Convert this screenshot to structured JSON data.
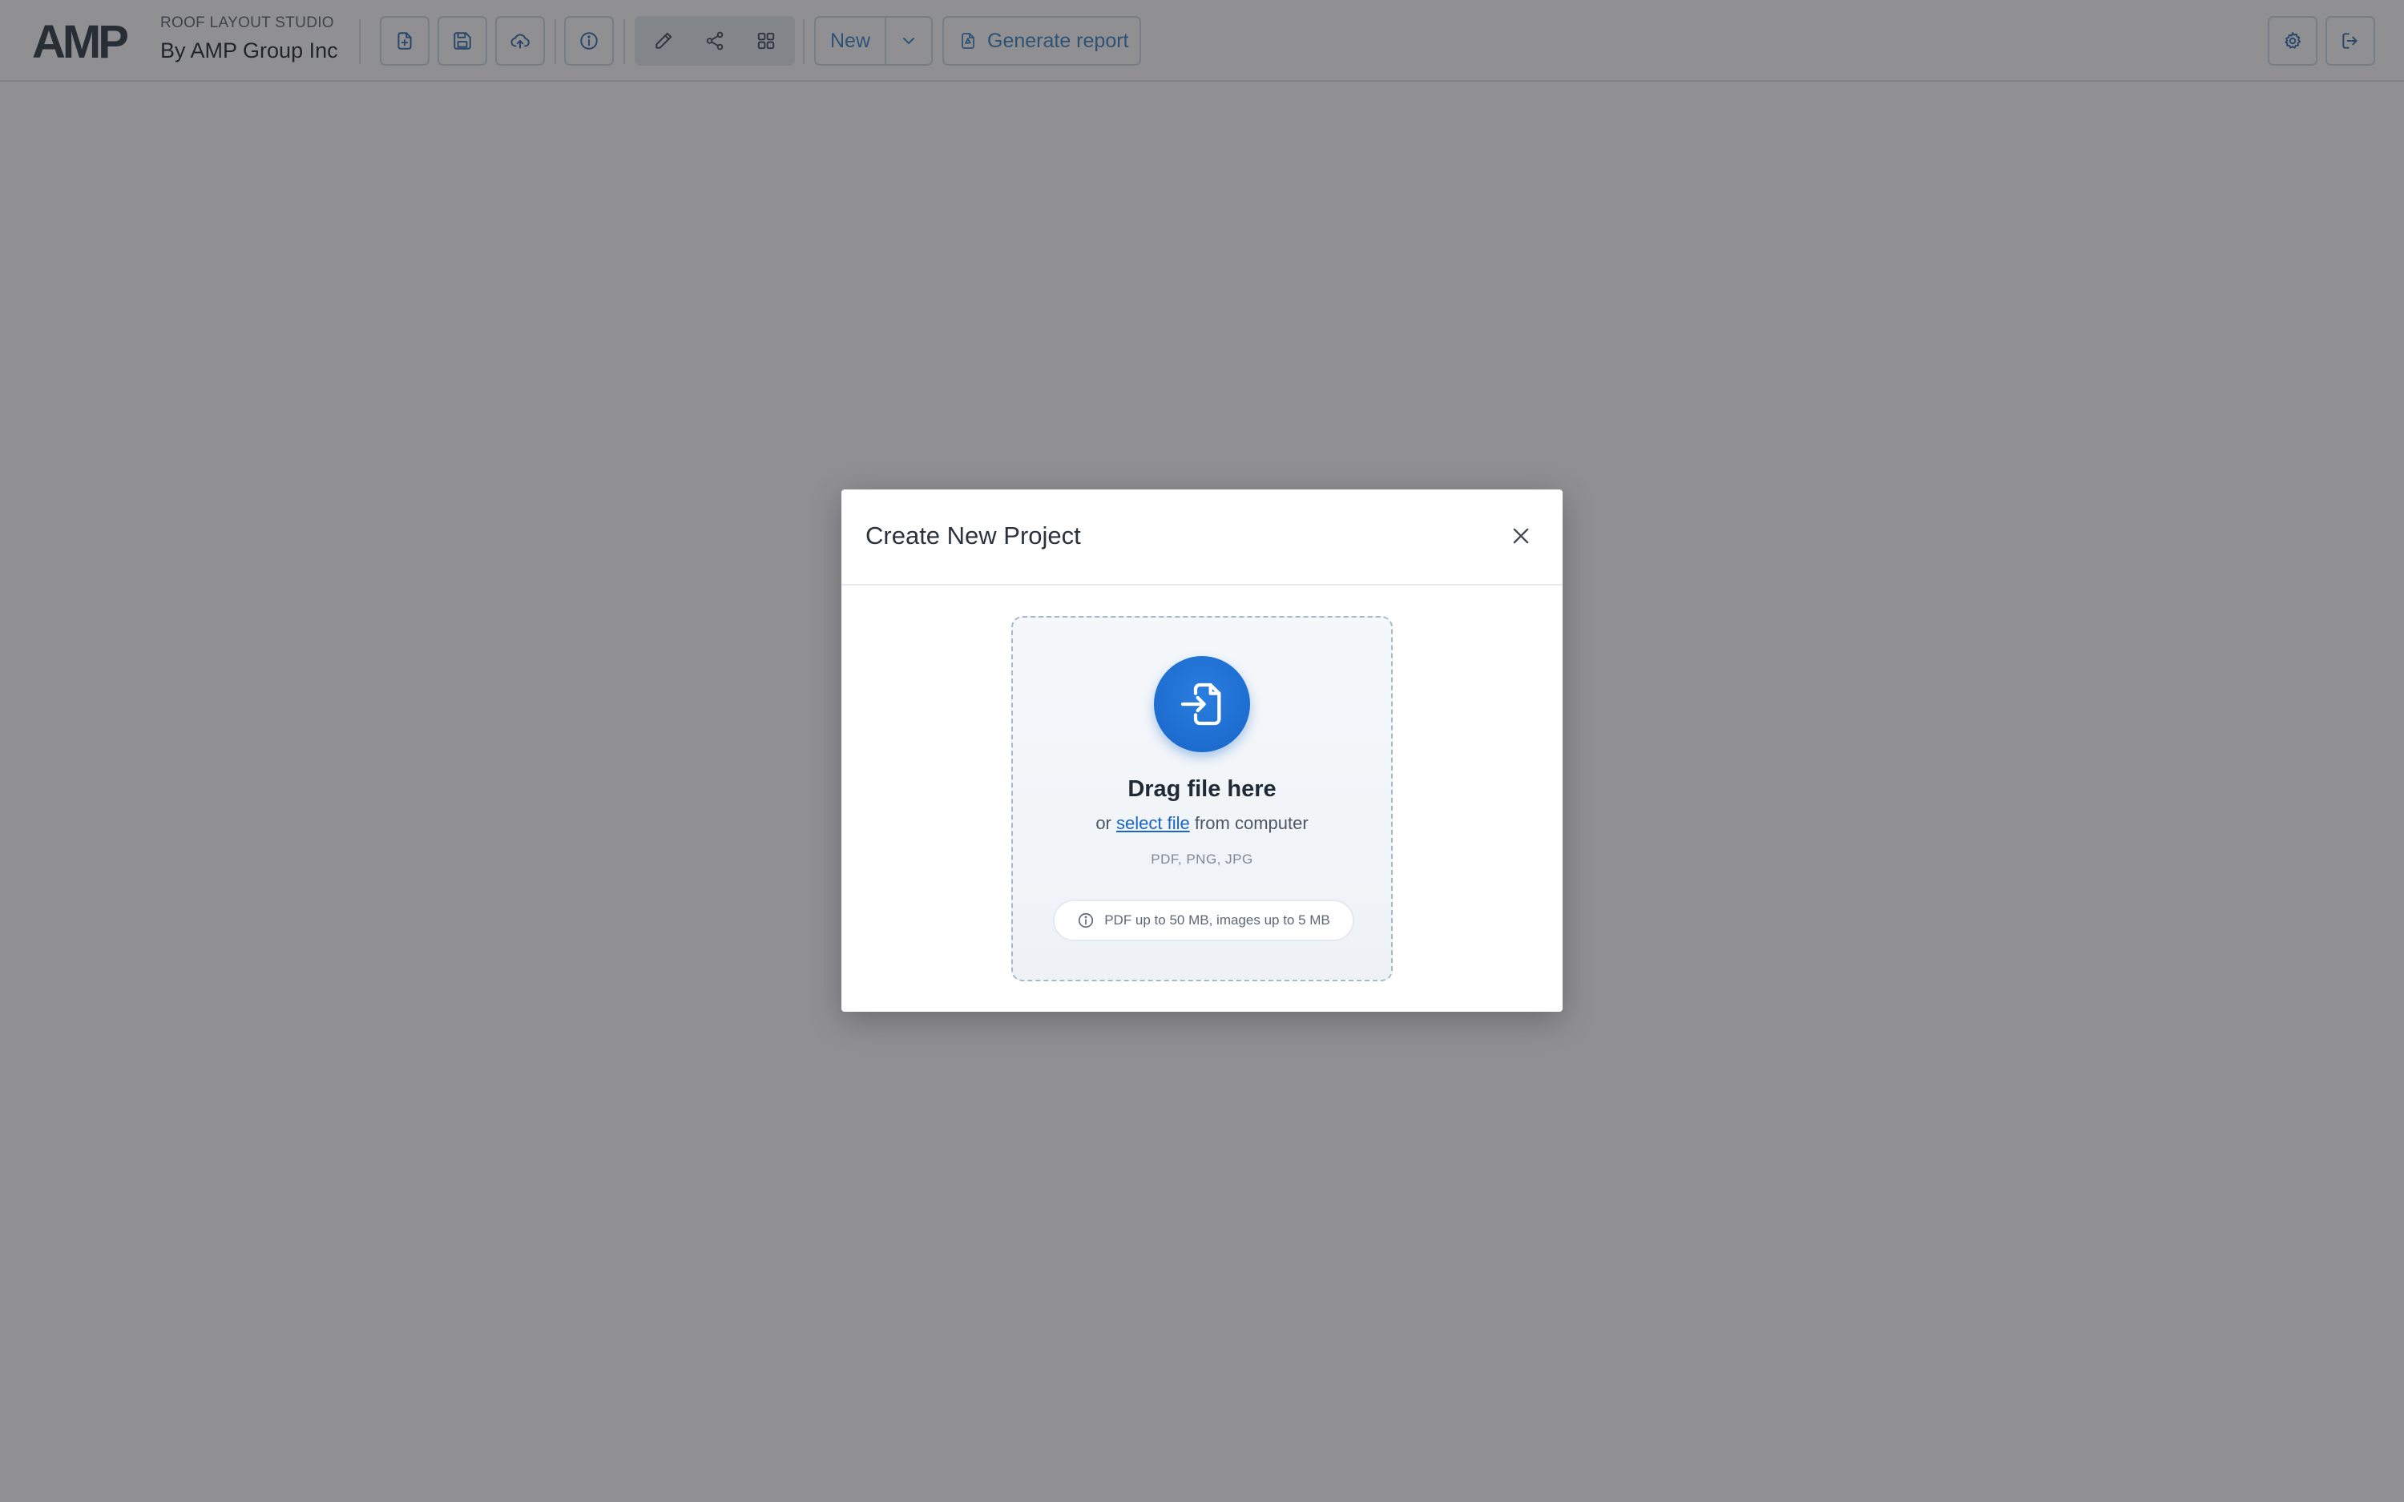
{
  "app": {
    "subtitle": "ROOF LAYOUT STUDIO",
    "title": "By AMP Group Inc",
    "logo_text": "AMP"
  },
  "toolbar": {
    "file_buttons": [
      {
        "icon": "file-plus-icon"
      },
      {
        "icon": "save-icon"
      },
      {
        "icon": "cloud-upload-icon"
      }
    ],
    "info_icon": "info-icon",
    "tools": [
      {
        "icon": "pencil-icon"
      },
      {
        "icon": "share-nodes-icon"
      },
      {
        "icon": "grid-icon"
      }
    ],
    "new_label": "New",
    "report_label": "Generate report",
    "right_buttons": [
      {
        "icon": "gear-icon"
      },
      {
        "icon": "logout-icon"
      }
    ]
  },
  "modal": {
    "title": "Create New Project",
    "dropzone": {
      "title": "Drag file here",
      "sub_prefix": "or",
      "sub_link": "select file",
      "sub_suffix": "from computer",
      "types": "PDF, PNG, JPG",
      "note": "PDF up to 50 MB, images up to 5 MB"
    }
  },
  "colors": {
    "accent": "#1766c8",
    "link": "#3b82c4",
    "overlay": "#8f8f90"
  }
}
